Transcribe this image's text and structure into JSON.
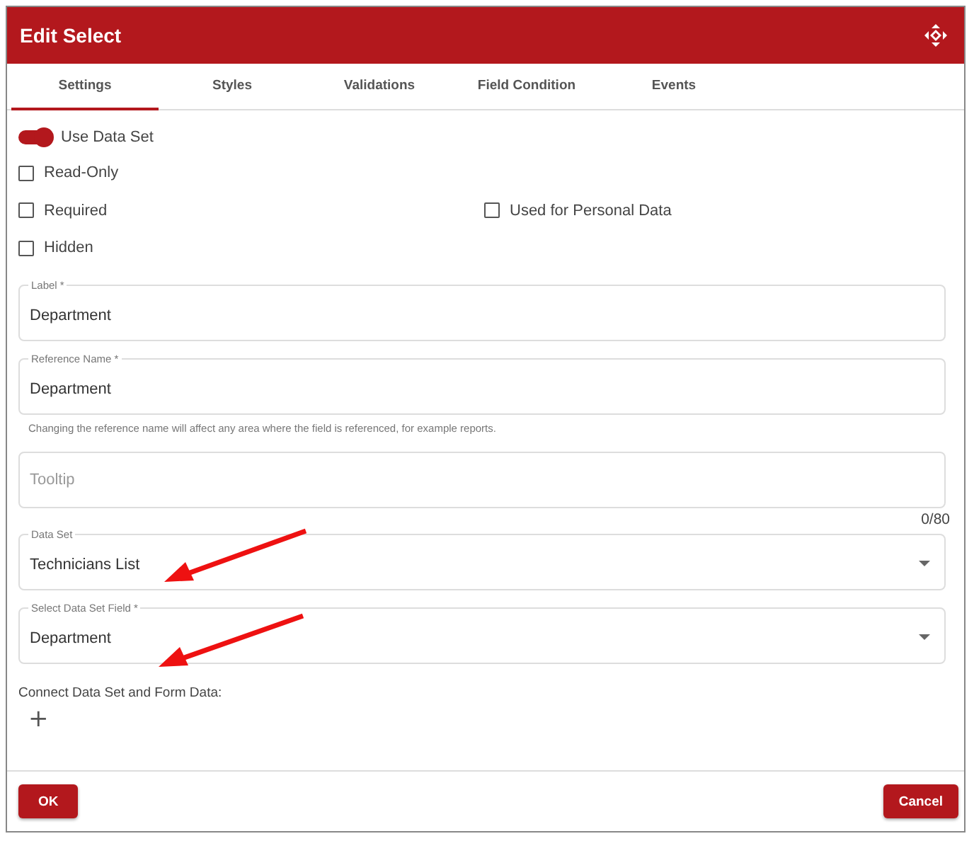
{
  "window": {
    "title": "Edit Select"
  },
  "tabs": [
    {
      "label": "Settings",
      "selected": true
    },
    {
      "label": "Styles",
      "selected": false
    },
    {
      "label": "Validations",
      "selected": false
    },
    {
      "label": "Field Condition",
      "selected": false
    },
    {
      "label": "Events",
      "selected": false
    }
  ],
  "toggle": {
    "label": "Use Data Set",
    "on": true
  },
  "checkbox_rows": [
    [
      {
        "label": "Read-Only",
        "checked": false
      }
    ],
    [
      {
        "label": "Required",
        "checked": false
      },
      {
        "label": "Used for Personal Data",
        "checked": false
      }
    ],
    [
      {
        "label": "Hidden",
        "checked": false
      }
    ]
  ],
  "fields": [
    {
      "kind": "text",
      "label": "Label *",
      "value": "Department"
    },
    {
      "kind": "text",
      "label": "Reference Name *",
      "value": "Department",
      "hint": "Changing the reference name will affect any area where the field is referenced, for example reports."
    },
    {
      "kind": "text",
      "placeholder": "Tooltip",
      "counter": "0/80"
    },
    {
      "kind": "select",
      "label": "Data Set",
      "value": "Technicians List"
    },
    {
      "kind": "select",
      "label": "Select Data Set Field *",
      "value": "Department"
    }
  ],
  "connect": {
    "label": "Connect Data Set and Form Data:",
    "add_button": "+"
  },
  "buttons": [
    {
      "label": "OK"
    },
    {
      "label": "Cancel"
    }
  ]
}
